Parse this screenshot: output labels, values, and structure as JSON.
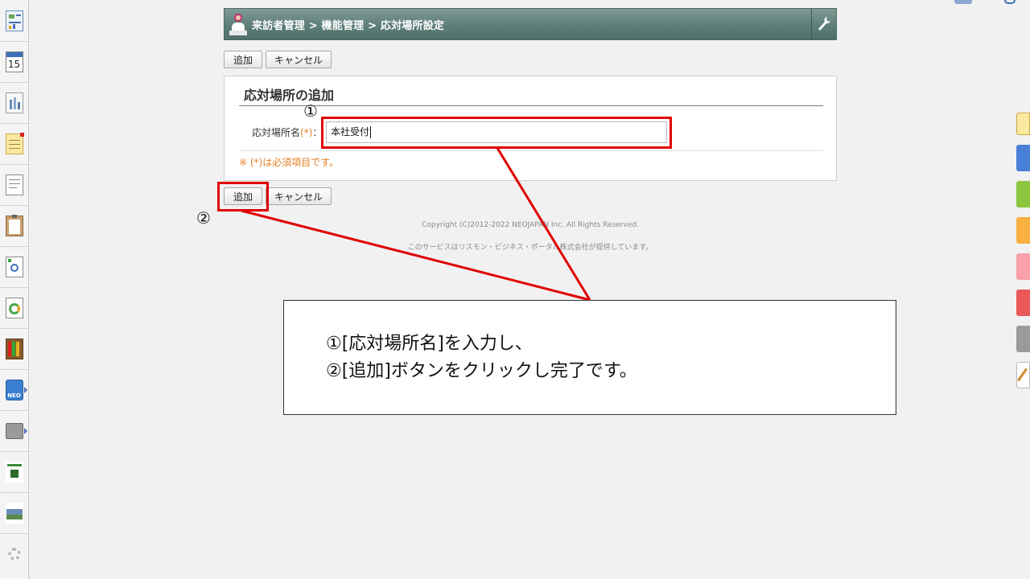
{
  "header": {
    "breadcrumb": "来訪者管理 > 機能管理 > 応対場所設定"
  },
  "toolbar_top": {
    "add_label": "追加",
    "cancel_label": "キャンセル"
  },
  "form": {
    "title": "応対場所の追加",
    "field_label": "応対場所名",
    "required_mark": "(*)",
    "field_sep": "：",
    "field_value": "本社受付",
    "required_note": "※ (*)は必須項目です。"
  },
  "toolbar_bottom": {
    "add_label": "追加",
    "cancel_label": "キャンセル"
  },
  "footer": {
    "copyright": "Copyright (C)2012-2022 NEOJAPAN Inc. All Rights Reserved.",
    "provider": "このサービスはリスモン・ビジネス・ポータル株式会社が提供しています。"
  },
  "annotations": {
    "marker_1": "①",
    "marker_2": "②",
    "callout_line_1": "①[応対場所名]を入力し、",
    "callout_line_2": "②[追加]ボタンをクリックし完了です。"
  },
  "sidebar": {
    "items": [
      {
        "icon": "portal-icon"
      },
      {
        "icon": "calendar-icon",
        "text": "15"
      },
      {
        "icon": "facility-icon"
      },
      {
        "icon": "memo-icon"
      },
      {
        "icon": "document-icon"
      },
      {
        "icon": "clipboard-icon"
      },
      {
        "icon": "search-doc-icon"
      },
      {
        "icon": "recycle-doc-icon"
      },
      {
        "icon": "cabinet-icon"
      },
      {
        "icon": "neo-icon",
        "text": "NEO"
      },
      {
        "icon": "folder-icon"
      },
      {
        "icon": "tanomaru-icon"
      },
      {
        "icon": "landscape-icon"
      },
      {
        "icon": "settings-icon"
      }
    ]
  },
  "colors": {
    "header": "#5c7c76",
    "highlight": "#e00000",
    "required": "#e67e22"
  }
}
